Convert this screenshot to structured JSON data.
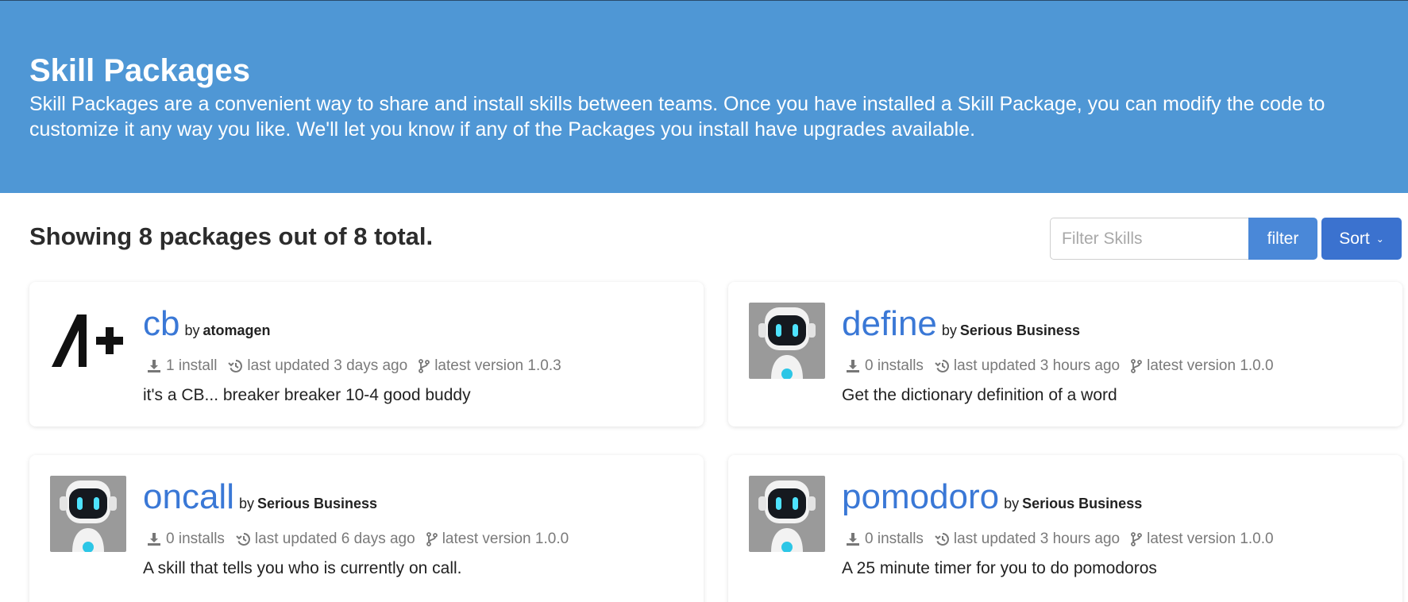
{
  "hero": {
    "title": "Skill Packages",
    "description": "Skill Packages are a convenient way to share and install skills between teams. Once you have installed a Skill Package, you can modify the code to customize it any way you like. We'll let you know if any of the Packages you install have upgrades available."
  },
  "toolbar": {
    "summary": "Showing 8 packages out of 8 total.",
    "filter_placeholder": "Filter Skills",
    "filter_label": "filter",
    "sort_label": "Sort"
  },
  "packages": [
    {
      "name": "cb",
      "by": "by",
      "author": "atomagen",
      "installs": "1 install",
      "updated": "last updated 3 days ago",
      "version": "latest version 1.0.3",
      "description": "it's a CB... breaker breaker 10-4 good buddy",
      "icon": "atomagen-logo"
    },
    {
      "name": "define",
      "by": "by",
      "author": "Serious Business",
      "installs": "0 installs",
      "updated": "last updated 3 hours ago",
      "version": "latest version 1.0.0",
      "description": "Get the dictionary definition of a word",
      "icon": "robot-avatar"
    },
    {
      "name": "oncall",
      "by": "by",
      "author": "Serious Business",
      "installs": "0 installs",
      "updated": "last updated 6 days ago",
      "version": "latest version 1.0.0",
      "description": "A skill that tells you who is currently on call.",
      "icon": "robot-avatar"
    },
    {
      "name": "pomodoro",
      "by": "by",
      "author": "Serious Business",
      "installs": "0 installs",
      "updated": "last updated 3 hours ago",
      "version": "latest version 1.0.0",
      "description": "A 25 minute timer for you to do pomodoros",
      "icon": "robot-avatar"
    }
  ],
  "colors": {
    "hero_bg": "#4f97d5",
    "link": "#3a78d6",
    "filter_btn": "#4a88d8",
    "sort_btn": "#3b72cf"
  }
}
